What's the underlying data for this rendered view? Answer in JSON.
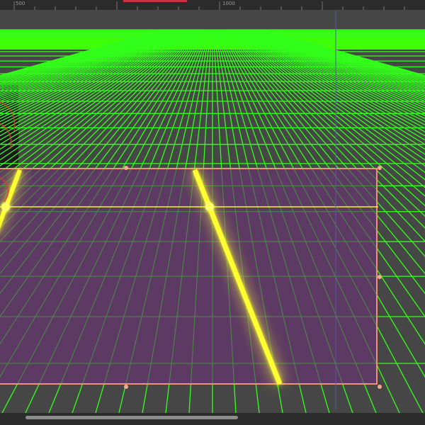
{
  "ruler": {
    "labels": [
      "500",
      "1000"
    ]
  },
  "colors": {
    "grid": "#33ff1a",
    "horizon_glow": "#44ff00",
    "selection_fill": "#5e3a66",
    "selection_border": "#f0907a",
    "road_line": "#ffff33",
    "canvas_bg": "#464646"
  },
  "icons": {
    "handle": "resize-handle-icon"
  }
}
